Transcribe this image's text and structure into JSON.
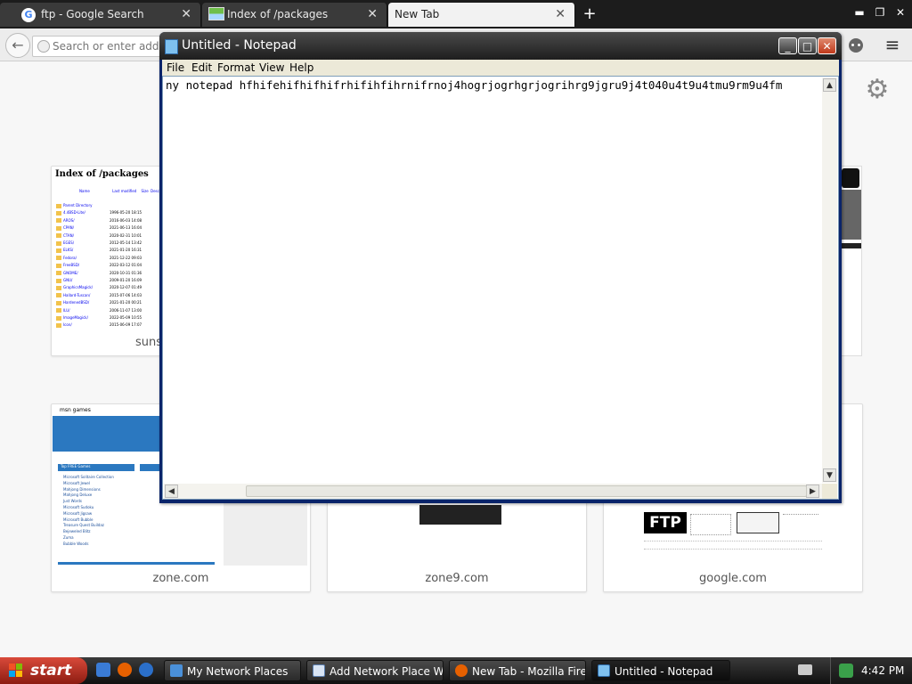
{
  "browser": {
    "tabs": [
      {
        "label": "ftp - Google Search",
        "favicon": "G",
        "close": "✕"
      },
      {
        "label": "Index of /packages",
        "close": "✕"
      },
      {
        "label": "New Tab",
        "close": "✕"
      }
    ],
    "new_tab_symbol": "+",
    "window_controls": {
      "minimize": "▬",
      "restore": "❐",
      "close": "✕"
    },
    "address_placeholder": "Search or enter address",
    "back_symbol": "←",
    "menu_symbol": "≡",
    "settings_symbol": "⚙"
  },
  "tiles": [
    {
      "caption": "suns",
      "thumb_title": "Index of /packages",
      "thumb_header": [
        "Name",
        "Last modified",
        "Size",
        "Desc"
      ],
      "thumb_rows": [
        {
          "name": "Parent Directory",
          "date": ""
        },
        {
          "name": "4.4BSD-Lite/",
          "date": "1996-05-20 18:15"
        },
        {
          "name": "AROS/",
          "date": "2016-06-03 14:08"
        },
        {
          "name": "CPAN/",
          "date": "2021-06-13 16:04"
        },
        {
          "name": "CTAN/",
          "date": "2020-02-31 10:01"
        },
        {
          "name": "EGES/",
          "date": "2012-05-14 13:42"
        },
        {
          "name": "ELKS/",
          "date": "2021-01-20 16:31"
        },
        {
          "name": "Fedora/",
          "date": "2021-12-22 09:03"
        },
        {
          "name": "FreeBSD/",
          "date": "2022-03-12 01:04"
        },
        {
          "name": "GNOME/",
          "date": "2020-10-31 01:36"
        },
        {
          "name": "GNU/",
          "date": "2009-01-20 16:09"
        },
        {
          "name": "GraphicsMagick/",
          "date": "2020-12-07 01:49"
        },
        {
          "name": "Hallard-Tuscan/",
          "date": "2015-07-06 14:03"
        },
        {
          "name": "HardenedBSD/",
          "date": "2021-01-20 00:21"
        },
        {
          "name": "ILU/",
          "date": "2006-11-07 13:00"
        },
        {
          "name": "ImageMagick/",
          "date": "2022-05-09 10:55"
        },
        {
          "name": "Icon/",
          "date": "2015-06-09 17:07"
        }
      ]
    },
    {
      "caption": "zone.com",
      "thumb_title": "msn games",
      "thumb_list_heading": "Top FREE Games",
      "thumb_list": [
        "Microsoft Solitaire Collection",
        "Microsoft Jewel",
        "Mahjong Dimensions",
        "Mahjong Deluxe",
        "Just Words",
        "Microsoft Sudoku",
        "Microsoft Jigsaw",
        "Microsoft Bubble",
        "Treasure Quest Buildaz",
        "Bejeweled Blitz",
        "Zuma",
        "Bubble Woods"
      ]
    },
    {
      "caption": "zone9.com"
    },
    {
      "caption": "google.com",
      "thumb_logo": "FTP"
    }
  ],
  "notepad": {
    "title": "Untitled - Notepad",
    "menus": [
      "File",
      "Edit",
      "Format",
      "View",
      "Help"
    ],
    "content": "ny notepad hfhifehifhifhifrhifihfihrnifrnoj4hogrjogrhgrjogrihrg9jgru9j4t040u4t9u4tmu9rm9u4fm",
    "controls": {
      "minimize": "_",
      "maximize": "□",
      "close": "✕"
    },
    "scroll_up": "▲",
    "scroll_down": "▼",
    "scroll_left": "◀",
    "scroll_right": "▶"
  },
  "taskbar": {
    "start_label": "start",
    "tasks": [
      {
        "label": "My Network Places",
        "active": false
      },
      {
        "label": "Add Network Place W...",
        "active": false
      },
      {
        "label": "New Tab - Mozilla Fire...",
        "active": false
      },
      {
        "label": "Untitled - Notepad",
        "active": true
      }
    ],
    "clock": "4:42 PM"
  }
}
